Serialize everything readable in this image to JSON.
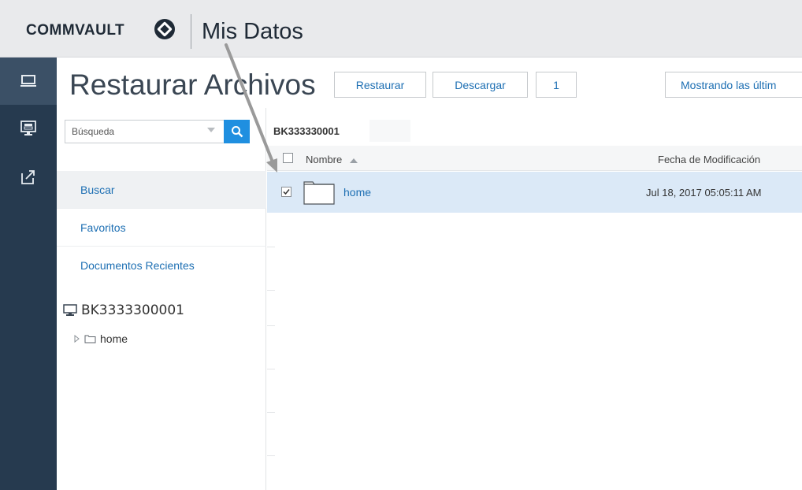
{
  "header": {
    "logo_text": "COMMVAULT",
    "logo_mark": "®",
    "app_title": "Mis Datos"
  },
  "rail": {
    "items": [
      {
        "icon": "laptop-icon",
        "active": true
      },
      {
        "icon": "server-icon",
        "active": false
      },
      {
        "icon": "share-icon",
        "active": false
      }
    ]
  },
  "page": {
    "title": "Restaurar Archivos"
  },
  "toolbar": {
    "restore_label": "Restaurar",
    "download_label": "Descargar",
    "count_label": "1",
    "showing_label": "Mostrando las últim"
  },
  "sidebar": {
    "search_placeholder": "Búsqueda",
    "links": [
      {
        "label": "Buscar",
        "active": true
      },
      {
        "label": "Favoritos",
        "active": false
      },
      {
        "label": "Documentos Recientes",
        "active": false
      }
    ],
    "tree": {
      "root_label": "BK3333300001",
      "child_label": "home"
    }
  },
  "browser": {
    "breadcrumb": "BK333330001",
    "columns": {
      "name": "Nombre",
      "modified": "Fecha de Modificación"
    },
    "rows": [
      {
        "name": "home",
        "modified": "Jul 18, 2017 05:05:11 AM",
        "checked": true
      }
    ]
  },
  "colors": {
    "rail": "#263a4f",
    "accent": "#1f8fe0",
    "link": "#1d6fb3",
    "selected_row": "#dbe9f7"
  }
}
